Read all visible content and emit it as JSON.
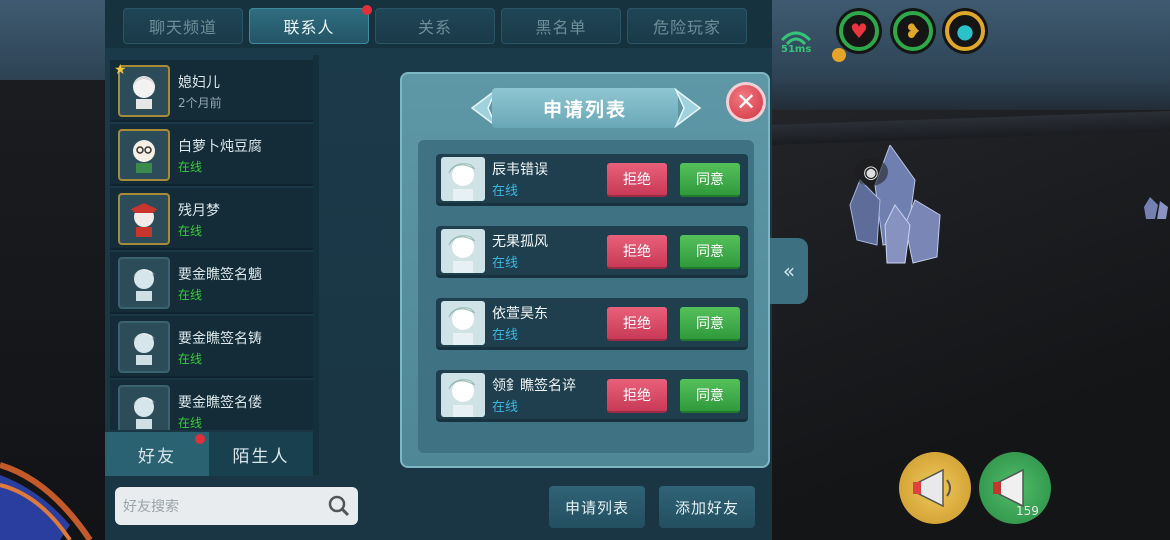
{
  "tabs": [
    {
      "label": "聊天频道",
      "active": false
    },
    {
      "label": "联系人",
      "active": true
    },
    {
      "label": "关系",
      "active": false
    },
    {
      "label": "黑名单",
      "active": false
    },
    {
      "label": "危险玩家",
      "active": false
    }
  ],
  "contacts": [
    {
      "name": "媳妇儿",
      "status": "2个月前"
    },
    {
      "name": "白萝卜炖豆腐",
      "status": "在线"
    },
    {
      "name": "残月梦",
      "status": "在线"
    },
    {
      "name": "要金瞧签名魑",
      "status": "在线"
    },
    {
      "name": "要金瞧签名铸",
      "status": "在线"
    },
    {
      "name": "要金瞧签名偻",
      "status": "在线"
    }
  ],
  "bottom_tabs": {
    "friends": "好友",
    "strangers": "陌生人"
  },
  "search": {
    "placeholder": "好友搜索"
  },
  "buttons": {
    "request_list": "申请列表",
    "add_friend": "添加好友"
  },
  "modal": {
    "title": "申请列表",
    "reject_label": "拒绝",
    "agree_label": "同意",
    "requests": [
      {
        "name": "辰韦错误",
        "status": "在线"
      },
      {
        "name": "无果孤风",
        "status": "在线"
      },
      {
        "name": "依萱昊东",
        "status": "在线"
      },
      {
        "name": "领釒瞧签名谇",
        "status": "在线"
      }
    ]
  },
  "hud": {
    "ping": "51ms",
    "megaphone_count": "159"
  },
  "colors": {
    "online": "#3ccb3c",
    "reject": "#d9475f",
    "agree": "#3fae47",
    "accent": "#2f6d80"
  }
}
